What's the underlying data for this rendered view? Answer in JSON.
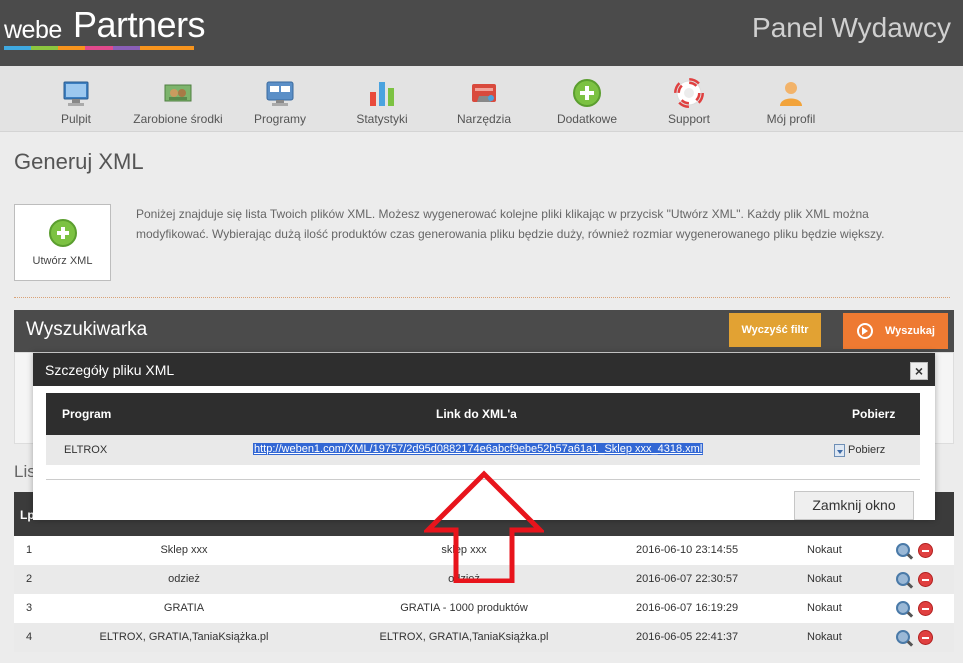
{
  "header": {
    "logo_prefix": "webe",
    "logo_main": "Partners",
    "logo_stripe_colors": [
      "#3fa9e0",
      "#8cc63f",
      "#f7941d",
      "#e14a8c",
      "#8a5fb8",
      "#f7941d",
      "#f7941d"
    ],
    "panel_title": "Panel Wydawcy"
  },
  "nav": {
    "items": [
      {
        "label": "Pulpit",
        "icon": "monitor-icon"
      },
      {
        "label": "Zarobione środki",
        "icon": "money-icon"
      },
      {
        "label": "Programy",
        "icon": "programs-icon"
      },
      {
        "label": "Statystyki",
        "icon": "bar-chart-icon"
      },
      {
        "label": "Narzędzia",
        "icon": "tools-icon"
      },
      {
        "label": "Dodatkowe",
        "icon": "plus-circle-icon"
      },
      {
        "label": "Support",
        "icon": "lifebuoy-icon"
      },
      {
        "label": "Mój profil",
        "icon": "user-icon"
      }
    ]
  },
  "page": {
    "title": "Generuj XML",
    "create_button": "Utwórz XML",
    "intro": "Poniżej znajduje się lista Twoich plików XML. Możesz wygenerować kolejne pliki klikając w przycisk \"Utwórz XML\". Każdy plik XML można modyfikować. Wybierając dużą ilość produktów czas generowania pliku będzie duży, również rozmiar wygenerowanego pliku będzie większy."
  },
  "search": {
    "title": "Wyszukiwarka",
    "clear_label": "Wyczyść filtr",
    "search_label": "Wyszukaj"
  },
  "list": {
    "heading": "Lis",
    "header_lp": "Lp",
    "rows": [
      {
        "lp": "1",
        "name": "Sklep xxx",
        "desc": "sklep xxx",
        "date": "2016-06-10 23:14:55",
        "status": "Nokaut"
      },
      {
        "lp": "2",
        "name": "odzież",
        "desc": "odzież",
        "date": "2016-06-07 22:30:57",
        "status": "Nokaut"
      },
      {
        "lp": "3",
        "name": "GRATIA",
        "desc": "GRATIA - 1000 produktów",
        "date": "2016-06-07 16:19:29",
        "status": "Nokaut"
      },
      {
        "lp": "4",
        "name": "ELTROX, GRATIA,TaniaKsiążka.pl",
        "desc": "ELTROX, GRATIA,TaniaKsiążka.pl",
        "date": "2016-06-05 22:41:37",
        "status": "Nokaut"
      }
    ]
  },
  "modal": {
    "title": "Szczegóły pliku XML",
    "close_symbol": "×",
    "col_program": "Program",
    "col_link": "Link do XML'a",
    "col_download": "Pobierz",
    "program": "ELTROX",
    "link": "http://weben1.com/XML/19757/2d95d0882174e6abcf9ebe52b57a61a1_Sklep xxx_4318.xml",
    "download_label": "Pobierz",
    "close_button": "Zamknij okno"
  },
  "colors": {
    "topbar": "#4b4b4b",
    "search_orange": "#ee7a32",
    "clear_amber": "#e2a233",
    "annotation_arrow": "#e8141c"
  }
}
